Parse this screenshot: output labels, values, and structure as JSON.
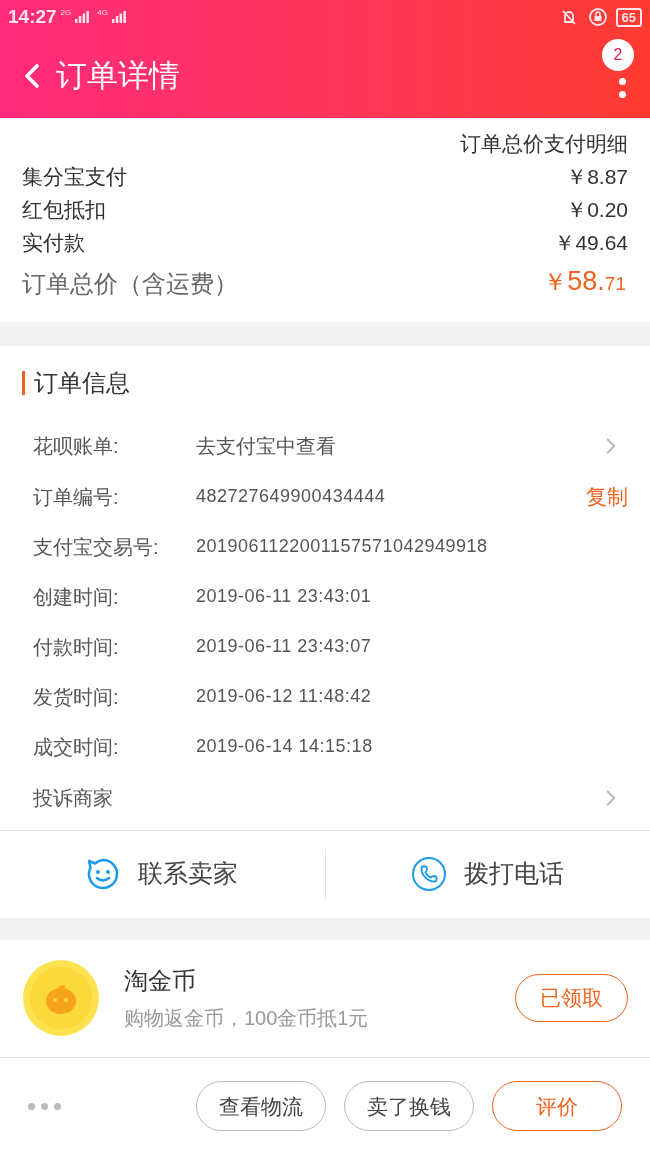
{
  "status_bar": {
    "time": "14:27",
    "signal_1": "2G",
    "signal_2": "4G",
    "battery": "65"
  },
  "header": {
    "title": "订单详情",
    "badge": "2"
  },
  "payment": {
    "heading": "订单总价支付明细",
    "rows": [
      {
        "label": "集分宝支付",
        "amount": "￥8.87"
      },
      {
        "label": "红包抵扣",
        "amount": "￥0.20"
      },
      {
        "label": "实付款",
        "amount": "￥49.64"
      }
    ],
    "total": {
      "label": "订单总价（含运费）",
      "currency": "￥",
      "integer": "58.",
      "decimal": "71"
    }
  },
  "order_info": {
    "title": "订单信息",
    "rows": [
      {
        "kind": "link",
        "label": "花呗账单:",
        "value": "去支付宝中查看"
      },
      {
        "kind": "copy",
        "label": "订单编号:",
        "value": "482727649900434444",
        "action": "复制"
      },
      {
        "kind": "plain",
        "label": "支付宝交易号:",
        "value": "2019061122001157571042949918"
      },
      {
        "kind": "plain",
        "label": "创建时间:",
        "value": "2019-06-11 23:43:01"
      },
      {
        "kind": "plain",
        "label": "付款时间:",
        "value": "2019-06-11 23:43:07"
      },
      {
        "kind": "plain",
        "label": "发货时间:",
        "value": "2019-06-12 11:48:42"
      },
      {
        "kind": "plain",
        "label": "成交时间:",
        "value": "2019-06-14 14:15:18"
      },
      {
        "kind": "link",
        "label": "投诉商家"
      }
    ]
  },
  "contact": [
    {
      "kind": "chat",
      "label": "联系卖家"
    },
    {
      "kind": "phone",
      "label": "拨打电话"
    }
  ],
  "coins": {
    "title": "淘金币",
    "subtitle": "购物返金币，100金币抵1元",
    "button": "已领取"
  },
  "actions": [
    {
      "label": "查看物流",
      "primary": false
    },
    {
      "label": "卖了换钱",
      "primary": false
    },
    {
      "label": "评价",
      "primary": true
    }
  ]
}
